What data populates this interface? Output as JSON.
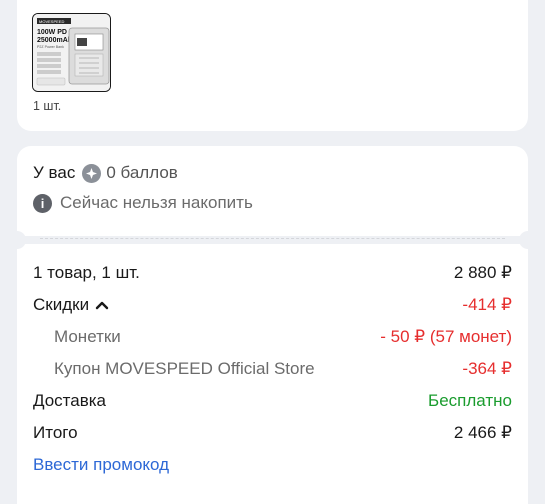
{
  "product": {
    "quantity": "1 шт.",
    "image_text": {
      "brand": "MOVESPEED",
      "line1": "100W PD",
      "line2": "25000mAh",
      "line3": "P2Z Power Bank"
    }
  },
  "points": {
    "prefix": "У вас",
    "balance": "0 баллов",
    "notice": "Сейчас нельзя накопить"
  },
  "summary": {
    "items_label": "1 товар, 1 шт.",
    "items_value": "2 880 ₽",
    "discounts_label": "Скидки",
    "discounts_value": "-414 ₽",
    "coins_label": "Монетки",
    "coins_value": "- 50 ₽ (57 монет)",
    "coupon_label": "Купон MOVESPEED Official Store",
    "coupon_value": "-364 ₽",
    "delivery_label": "Доставка",
    "delivery_value": "Бесплатно",
    "total_label": "Итого",
    "total_value": "2 466 ₽",
    "promo_link": "Ввести промокод"
  },
  "colors": {
    "discount": "#e62e2e",
    "free": "#1a9c2e",
    "link": "#2d68d6"
  },
  "icons": [
    "coin-icon",
    "info-icon",
    "chevron-up-icon"
  ]
}
